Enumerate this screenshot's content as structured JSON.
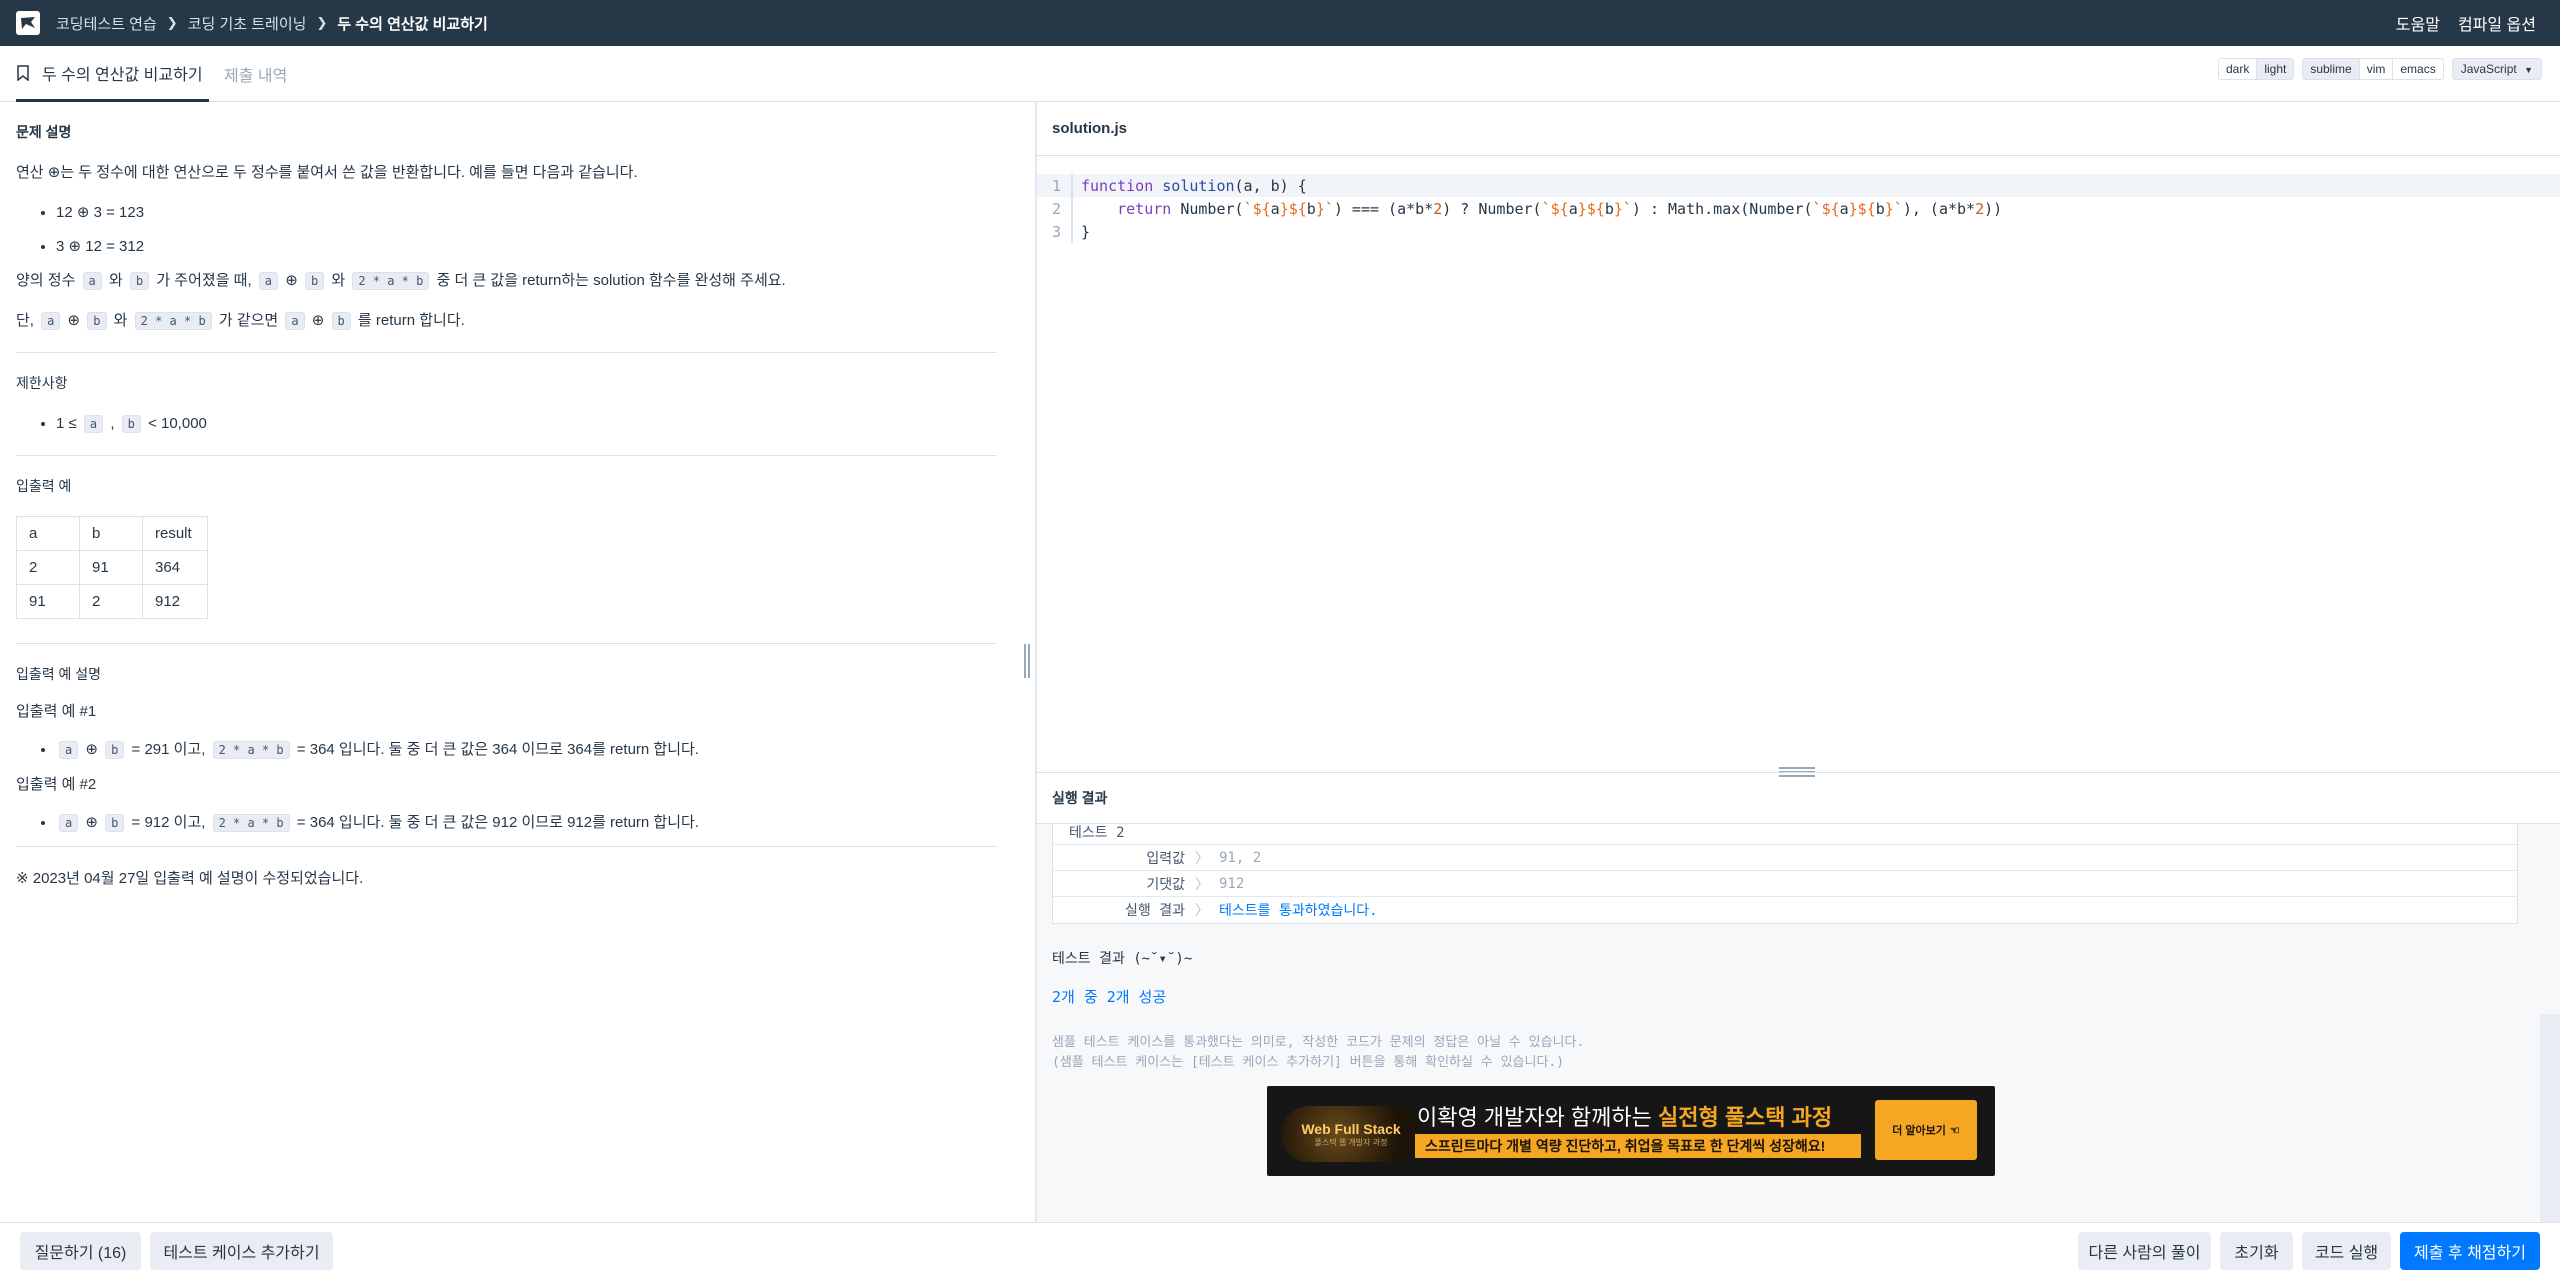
{
  "nav": {
    "breadcrumbs": [
      "코딩테스트 연습",
      "코딩 기초 트레이닝",
      "두 수의 연산값 비교하기"
    ],
    "help": "도움말",
    "compile_options": "컴파일 옵션"
  },
  "tabs": {
    "problem": "두 수의 연산값 비교하기",
    "submissions": "제출 내역"
  },
  "toolbar": {
    "themes": [
      "dark",
      "light"
    ],
    "keymaps": [
      "sublime",
      "vim",
      "emacs"
    ],
    "language": "JavaScript"
  },
  "problem": {
    "desc_title": "문제 설명",
    "desc_intro": "연산 ⊕는 두 정수에 대한 연산으로 두 정수를 붙여서 쓴 값을 반환합니다. 예를 들면 다음과 같습니다.",
    "examples": [
      "12 ⊕ 3 = 123",
      "3 ⊕ 12 = 312"
    ],
    "task": {
      "t1": "양의 정수 ",
      "c_a": "a",
      "t2": " 와 ",
      "c_b": "b",
      "t3": " 가 주어졌을 때, ",
      "t4": " ⊕ ",
      "t5": " 와 ",
      "c_expr": "2 * a * b",
      "t6": " 중 더 큰 값을 return하는 solution 함수를 완성해 주세요."
    },
    "note": {
      "t1": "단, ",
      "t2": " ⊕ ",
      "t3": " 와 ",
      "t4": " 가 같으면 ",
      "t5": " ⊕ ",
      "t6": " 를 return 합니다."
    },
    "constraints_title": "제한사항",
    "constraint": {
      "t1": "1 ≤ ",
      "t2": " , ",
      "t3": " < 10,000"
    },
    "io_title": "입출력 예",
    "io_table": {
      "headers": [
        "a",
        "b",
        "result"
      ],
      "rows": [
        [
          "2",
          "91",
          "364"
        ],
        [
          "91",
          "2",
          "912"
        ]
      ]
    },
    "io_desc_title": "입출력 예 설명",
    "io_example1_title": "입출력 예 #1",
    "io_example1": {
      "t1": " ⊕ ",
      "t2": " = 291 이고, ",
      "t3": " = 364 입니다. 둘 중 더 큰 값은 364 이므로 364를 return 합니다."
    },
    "io_example2_title": "입출력 예 #2",
    "io_example2": {
      "t1": " ⊕ ",
      "t2": " = 912 이고, ",
      "t3": " = 364 입니다. 둘 중 더 큰 값은 912 이므로 912를 return 합니다."
    },
    "footnote": "※ 2023년 04월 27일 입출력 예 설명이 수정되었습니다."
  },
  "editor": {
    "filename": "solution.js",
    "line_numbers": [
      "1",
      "2",
      "3"
    ]
  },
  "result": {
    "title": "실행 결과",
    "test_name": "테스트 2",
    "input_label": "입력값",
    "input_value": "91, 2",
    "expected_label": "기댓값",
    "expected_value": "912",
    "exec_label": "실행 결과",
    "exec_value": "테스트를 통과하였습니다.",
    "sep": "〉",
    "summary_title": "테스트 결과 (~˘▾˘)~",
    "summary_count": "2개 중 2개 성공",
    "disclaimer1": "샘플 테스트 케이스를 통과했다는 의미로, 작성한 코드가 문제의 정답은 아닐 수 있습니다.",
    "disclaimer2": "(샘플 테스트 케이스는 [테스트 케이스 추가하기] 버튼을 통해 확인하실 수 있습니다.)"
  },
  "ad": {
    "logo": "Web Full Stack",
    "logo_sub": "풀스택 웹 개발자 과정",
    "title_pre": "이확영 개발자와 함께하는 ",
    "title_em": "실전형 풀스택 과정",
    "subtitle": "스프린트마다 개별 역량 진단하고, 취업을 목표로 한 단계씩 성장해요!",
    "cta": "더 알아보기"
  },
  "bottom": {
    "ask": "질문하기 (16)",
    "add_test": "테스트 케이스 추가하기",
    "others": "다른 사람의 풀이",
    "reset": "초기화",
    "run": "코드 실행",
    "submit": "제출 후 채점하기"
  },
  "colors": {
    "nav_bg": "#263747",
    "primary": "#0078ff",
    "ad_accent": "#f5a623"
  }
}
